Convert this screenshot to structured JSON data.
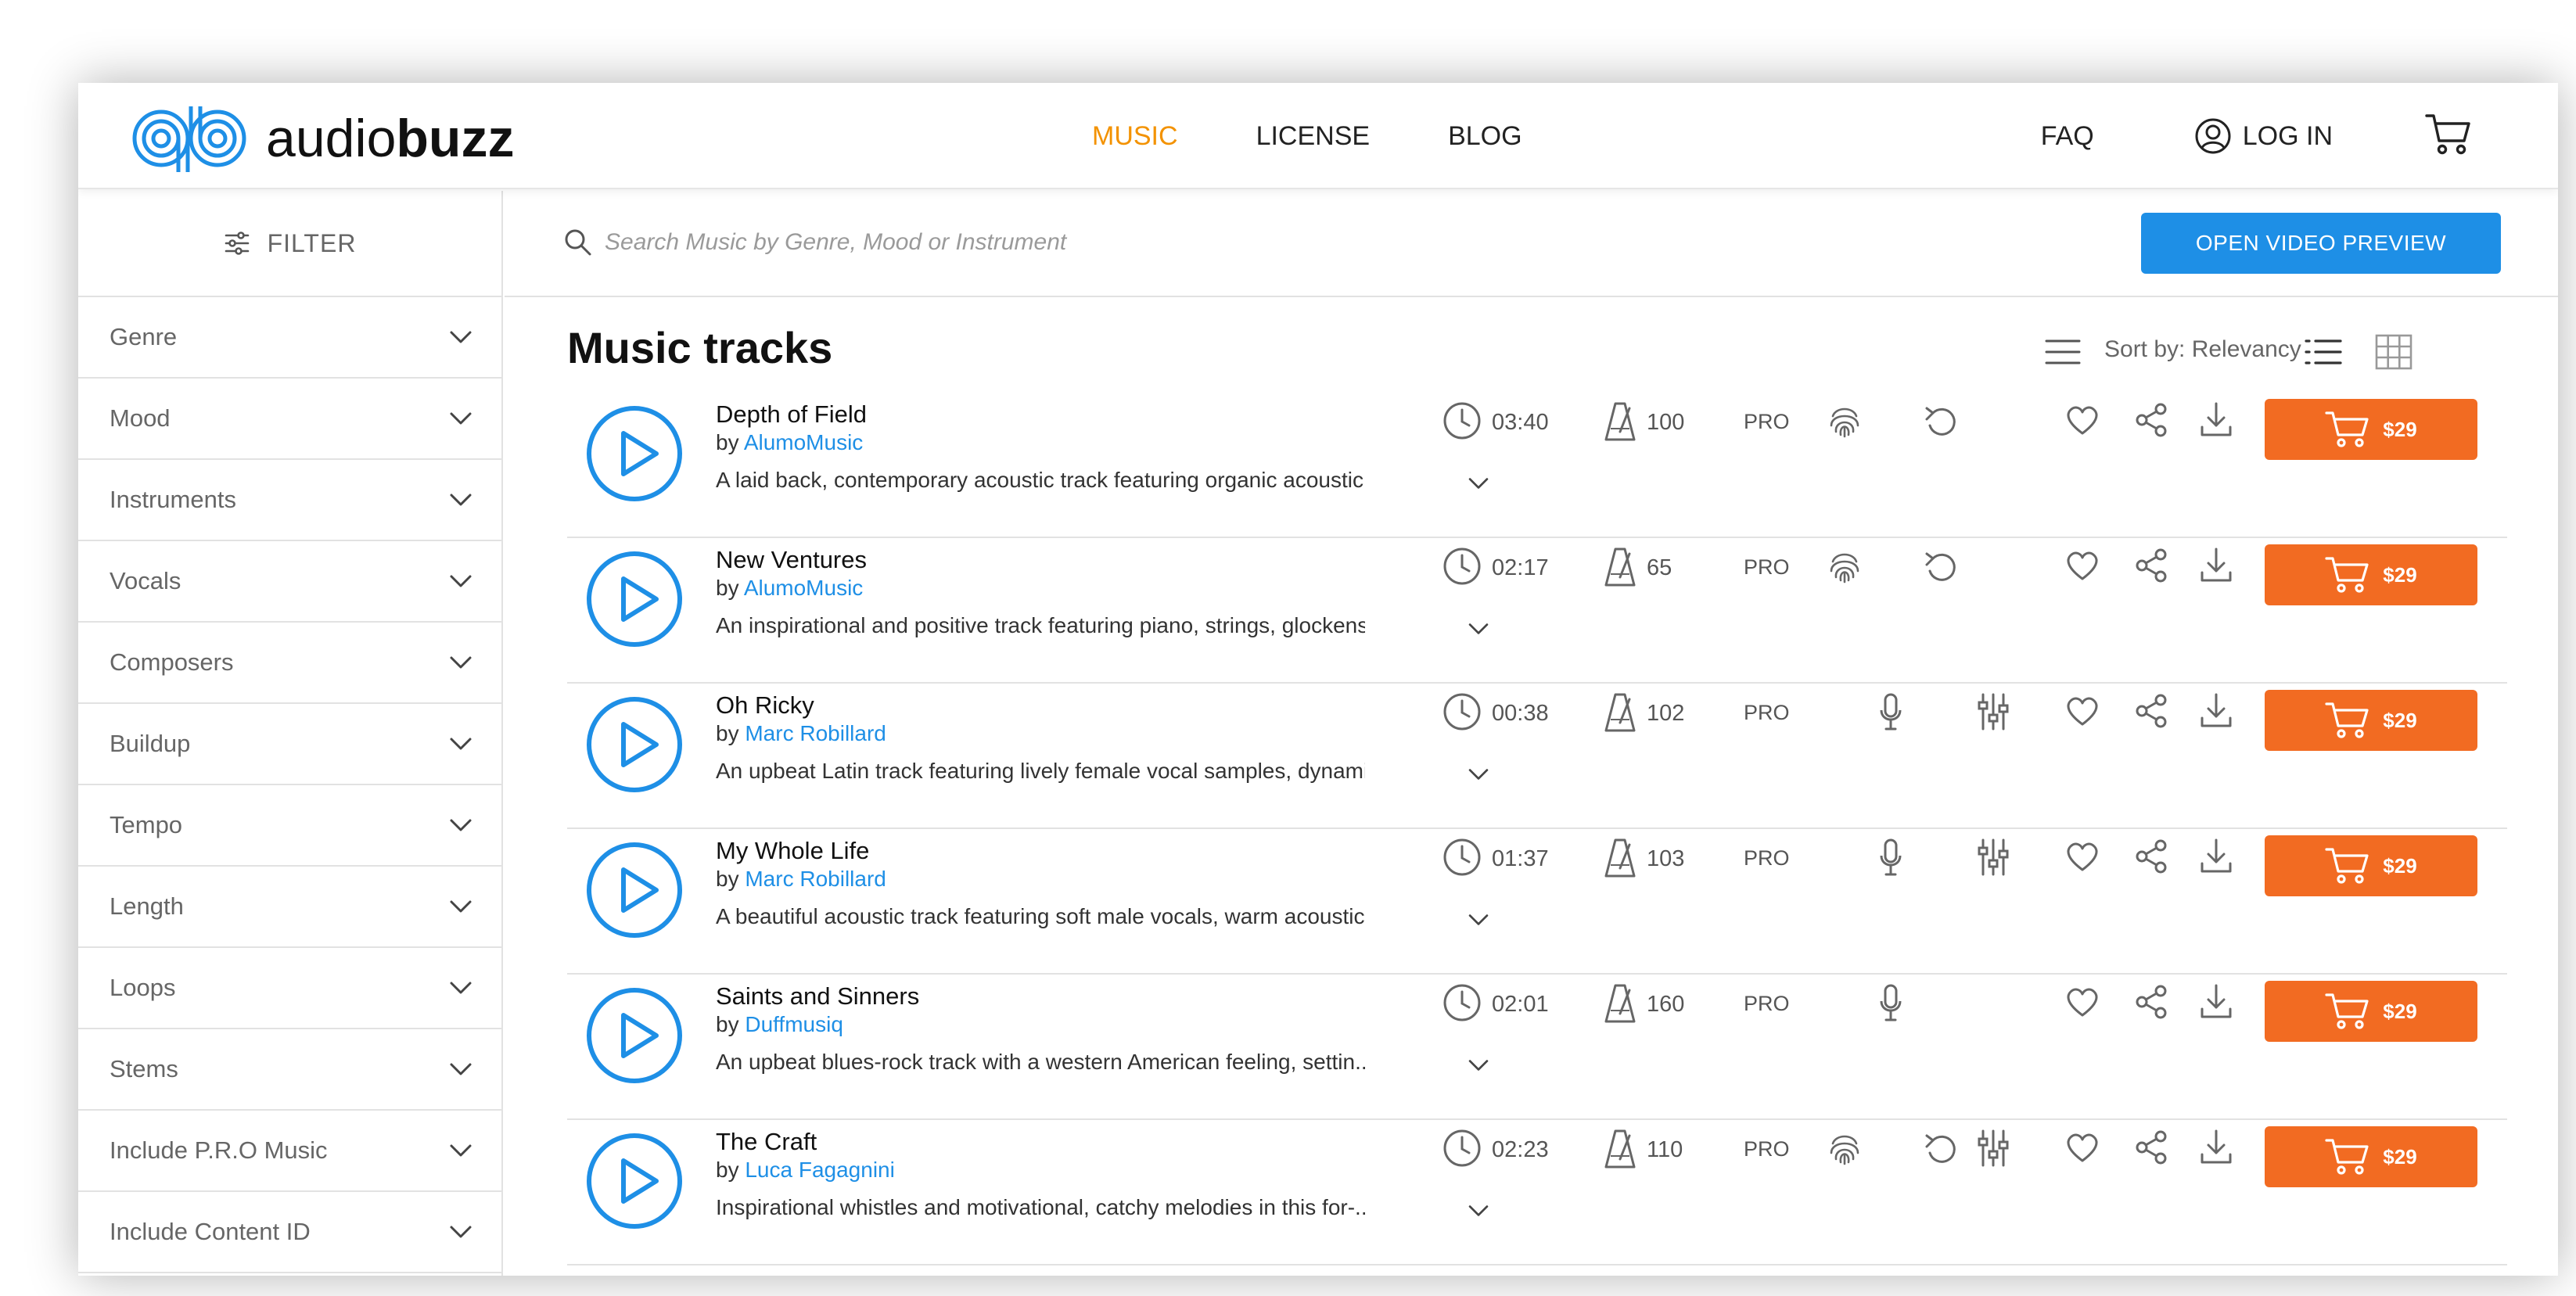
{
  "brand": {
    "logo_light": "audio",
    "logo_bold": "buzz"
  },
  "nav": {
    "music": "MUSIC",
    "license": "LICENSE",
    "blog": "BLOG",
    "faq": "FAQ",
    "login": "LOG IN"
  },
  "sidebar": {
    "filter_label": "FILTER",
    "items": [
      {
        "label": "Genre"
      },
      {
        "label": "Mood"
      },
      {
        "label": "Instruments"
      },
      {
        "label": "Vocals"
      },
      {
        "label": "Composers"
      },
      {
        "label": "Buildup"
      },
      {
        "label": "Tempo"
      },
      {
        "label": "Length"
      },
      {
        "label": "Loops"
      },
      {
        "label": "Stems"
      },
      {
        "label": "Include P.R.O Music"
      },
      {
        "label": "Include Content ID"
      }
    ]
  },
  "search": {
    "placeholder": "Search Music by Genre, Mood or Instrument",
    "video_button": "OPEN VIDEO PREVIEW"
  },
  "list": {
    "title": "Music tracks",
    "sort_label": "Sort by: Relevancy"
  },
  "tracks": [
    {
      "title": "Depth of Field",
      "by": "by",
      "artist": "AlumoMusic",
      "desc": "A laid back, contemporary acoustic track featuring organic acoustic...",
      "duration": "03:40",
      "bpm": "100",
      "pro": "PRO",
      "price": "$29"
    },
    {
      "title": "New Ventures",
      "by": "by",
      "artist": "AlumoMusic",
      "desc": "An inspirational and positive track featuring piano, strings, glockens...",
      "duration": "02:17",
      "bpm": "65",
      "pro": "PRO",
      "price": "$29"
    },
    {
      "title": "Oh Ricky",
      "by": "by",
      "artist": "Marc Robillard",
      "desc": "An upbeat Latin track featuring lively female vocal samples, dynami...",
      "duration": "00:38",
      "bpm": "102",
      "pro": "PRO",
      "price": "$29"
    },
    {
      "title": "My Whole Life",
      "by": "by",
      "artist": "Marc Robillard",
      "desc": "A beautiful acoustic track featuring soft male vocals, warm acoustic...",
      "duration": "01:37",
      "bpm": "103",
      "pro": "PRO",
      "price": "$29"
    },
    {
      "title": "Saints and Sinners",
      "by": "by",
      "artist": "Duffmusiq",
      "desc": "An upbeat blues-rock track with a western American feeling, settin...",
      "duration": "02:01",
      "bpm": "160",
      "pro": "PRO",
      "price": "$29"
    },
    {
      "title": "The Craft",
      "by": "by",
      "artist": "Luca Fagagnini",
      "desc": "Inspirational whistles and motivational, catchy melodies in this for-...",
      "duration": "02:23",
      "bpm": "110",
      "pro": "PRO",
      "price": "$29"
    }
  ],
  "colors": {
    "accent_orange": "#f39200",
    "buy_orange": "#f26b22",
    "link_blue": "#1e8fe6"
  }
}
